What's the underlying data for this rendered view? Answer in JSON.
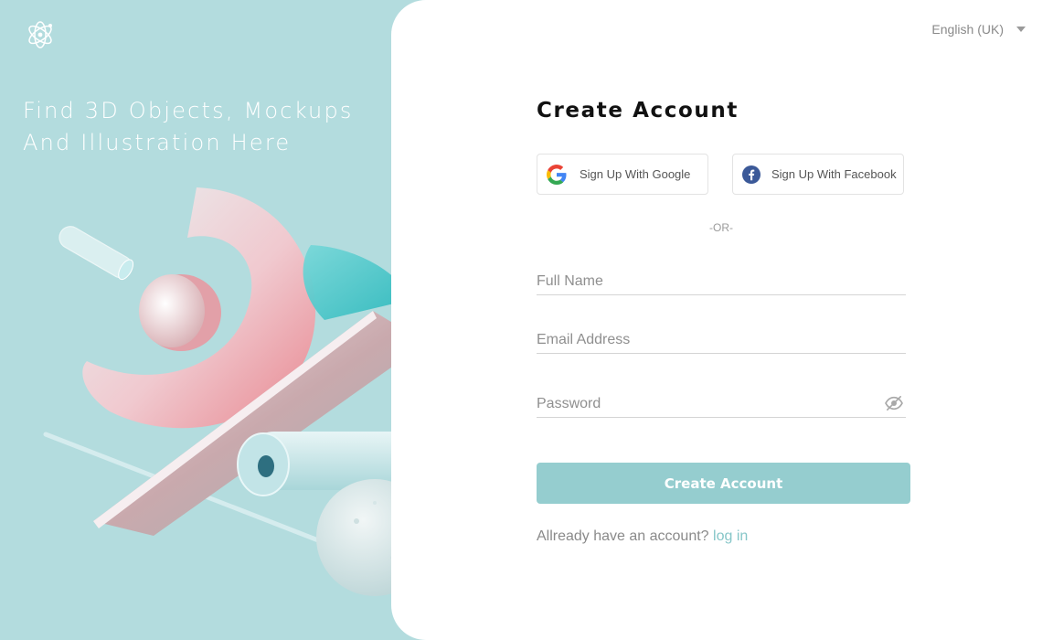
{
  "brand": {
    "logo_icon": "atom-icon"
  },
  "hero": {
    "title_line1": "Find 3D Objects, Mockups",
    "title_line2": "And Illustration Here"
  },
  "language": {
    "selected": "English (UK)",
    "icon": "chevron-down-icon"
  },
  "form": {
    "title": "Create Account",
    "google_label": "Sign Up With Google",
    "facebook_label": "Sign Up With Facebook",
    "divider": "-OR-",
    "full_name_placeholder": "Full Name",
    "email_placeholder": "Email Address",
    "password_placeholder": "Password",
    "password_toggle_icon": "eye-slash-icon",
    "submit_label": "Create Account",
    "login_prompt": "Allready have an account?",
    "login_link": "log in"
  },
  "colors": {
    "background": "#b3dcde",
    "panel": "#ffffff",
    "primary_button": "#95cdcf",
    "link": "#86c6c8",
    "heading": "#111111"
  }
}
